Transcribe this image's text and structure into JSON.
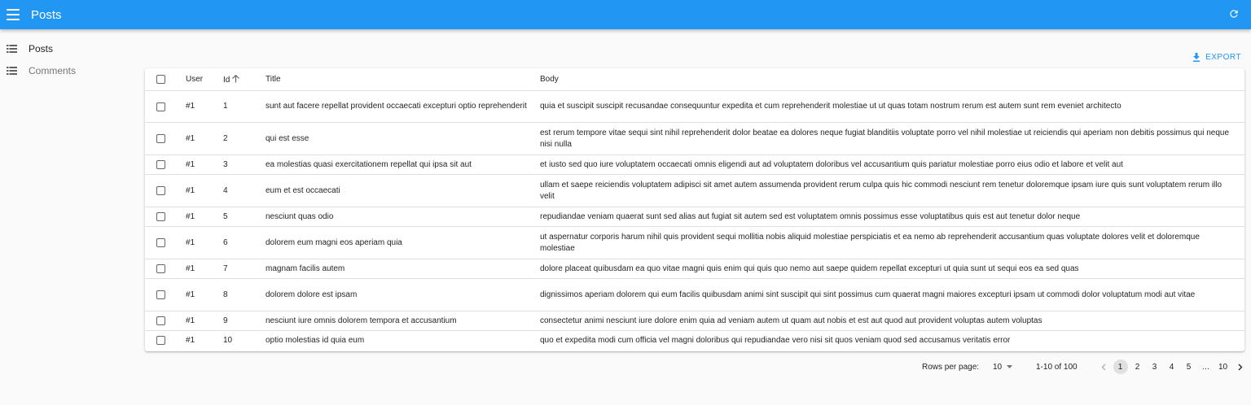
{
  "app": {
    "title": "Posts"
  },
  "icons": {
    "menu": "menu-icon",
    "refresh": "refresh-icon",
    "list": "list-icon",
    "export": "download-icon",
    "sort": "arrow-up-icon",
    "caret": "caret-down-icon",
    "prev": "chevron-left-icon",
    "next": "chevron-right-icon"
  },
  "colors": {
    "primary": "#2196f3"
  },
  "sidebar": {
    "items": [
      {
        "label": "Posts"
      },
      {
        "label": "Comments"
      }
    ]
  },
  "toolbar": {
    "export_label": "EXPORT"
  },
  "table": {
    "headers": {
      "user": "User",
      "id": "Id",
      "title": "Title",
      "body": "Body"
    },
    "rows": [
      {
        "user": "#1",
        "id": "1",
        "title": "sunt aut facere repellat provident occaecati excepturi optio reprehenderit",
        "body": "quia et suscipit suscipit recusandae consequuntur expedita et cum reprehenderit molestiae ut ut quas totam nostrum rerum est autem sunt rem eveniet architecto"
      },
      {
        "user": "#1",
        "id": "2",
        "title": "qui est esse",
        "body": "est rerum tempore vitae sequi sint nihil reprehenderit dolor beatae ea dolores neque fugiat blanditiis voluptate porro vel nihil molestiae ut reiciendis qui aperiam non debitis possimus qui neque nisi nulla"
      },
      {
        "user": "#1",
        "id": "3",
        "title": "ea molestias quasi exercitationem repellat qui ipsa sit aut",
        "body": "et iusto sed quo iure voluptatem occaecati omnis eligendi aut ad voluptatem doloribus vel accusantium quis pariatur molestiae porro eius odio et labore et velit aut"
      },
      {
        "user": "#1",
        "id": "4",
        "title": "eum et est occaecati",
        "body": "ullam et saepe reiciendis voluptatem adipisci sit amet autem assumenda provident rerum culpa quis hic commodi nesciunt rem tenetur doloremque ipsam iure quis sunt voluptatem rerum illo velit"
      },
      {
        "user": "#1",
        "id": "5",
        "title": "nesciunt quas odio",
        "body": "repudiandae veniam quaerat sunt sed alias aut fugiat sit autem sed est voluptatem omnis possimus esse voluptatibus quis est aut tenetur dolor neque"
      },
      {
        "user": "#1",
        "id": "6",
        "title": "dolorem eum magni eos aperiam quia",
        "body": "ut aspernatur corporis harum nihil quis provident sequi mollitia nobis aliquid molestiae perspiciatis et ea nemo ab reprehenderit accusantium quas voluptate dolores velit et doloremque molestiae"
      },
      {
        "user": "#1",
        "id": "7",
        "title": "magnam facilis autem",
        "body": "dolore placeat quibusdam ea quo vitae magni quis enim qui quis quo nemo aut saepe quidem repellat excepturi ut quia sunt ut sequi eos ea sed quas"
      },
      {
        "user": "#1",
        "id": "8",
        "title": "dolorem dolore est ipsam",
        "body": "dignissimos aperiam dolorem qui eum facilis quibusdam animi sint suscipit qui sint possimus cum quaerat magni maiores excepturi ipsam ut commodi dolor voluptatum modi aut vitae"
      },
      {
        "user": "#1",
        "id": "9",
        "title": "nesciunt iure omnis dolorem tempora et accusantium",
        "body": "consectetur animi nesciunt iure dolore enim quia ad veniam autem ut quam aut nobis et est aut quod aut provident voluptas autem voluptas"
      },
      {
        "user": "#1",
        "id": "10",
        "title": "optio molestias id quia eum",
        "body": "quo et expedita modi cum officia vel magni doloribus qui repudiandae vero nisi sit quos veniam quod sed accusamus veritatis error"
      }
    ]
  },
  "pagination": {
    "rows_per_page_label": "Rows per page:",
    "rows_per_page_value": "10",
    "range": "1-10 of 100",
    "current_page": "1",
    "pages": [
      "1",
      "2",
      "3",
      "4",
      "5",
      "…",
      "10"
    ]
  }
}
